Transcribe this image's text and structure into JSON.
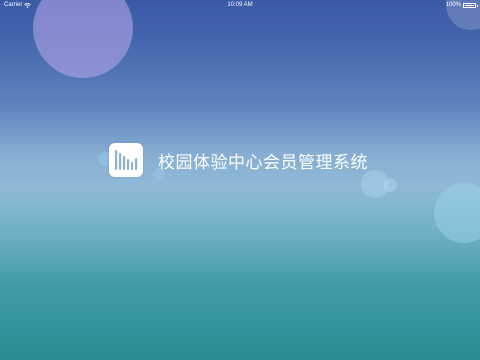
{
  "status_bar": {
    "carrier": "Carrier",
    "time": "10:09 AM",
    "battery_percent": "100%",
    "battery_level": 1.0
  },
  "splash": {
    "icon": "bar-chart-app-icon",
    "title": "校园体验中心会员管理系统"
  },
  "colors": {
    "gradient_top": "#3a5aa6",
    "gradient_middle": "#8fbad7",
    "gradient_bottom": "#2a8d93",
    "icon_bars": "#8bb4cf"
  }
}
